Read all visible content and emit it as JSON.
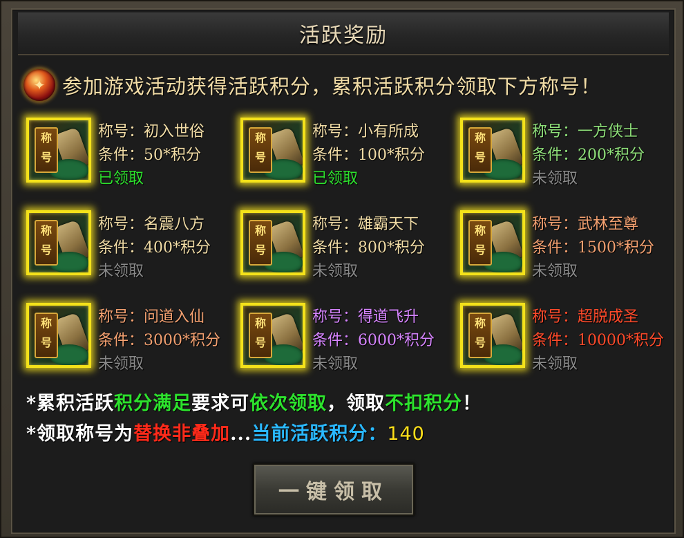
{
  "header": {
    "title": "活跃奖励"
  },
  "intro": {
    "orb_icon": "activity-orb-icon",
    "text": "参加游戏活动获得活跃积分，累积活跃积分领取下方称号！"
  },
  "titles": [
    {
      "name": "称号：初入世俗",
      "condition": "条件：50*积分",
      "status": "已领取",
      "claimed": true,
      "color": "#f1dca6"
    },
    {
      "name": "称号：小有所成",
      "condition": "条件：100*积分",
      "status": "已领取",
      "claimed": true,
      "color": "#f1dca6"
    },
    {
      "name": "称号：一方侠士",
      "condition": "条件：200*积分",
      "status": "未领取",
      "claimed": false,
      "color": "#8fe07a"
    },
    {
      "name": "称号：名震八方",
      "condition": "条件：400*积分",
      "status": "未领取",
      "claimed": false,
      "color": "#f1dca6"
    },
    {
      "name": "称号：雄霸天下",
      "condition": "条件：800*积分",
      "status": "未领取",
      "claimed": false,
      "color": "#f1dca6"
    },
    {
      "name": "称号：武林至尊",
      "condition": "条件：1500*积分",
      "status": "未领取",
      "claimed": false,
      "color": "#f3a070"
    },
    {
      "name": "称号：问道入仙",
      "condition": "条件：3000*积分",
      "status": "未领取",
      "claimed": false,
      "color": "#f3a070"
    },
    {
      "name": "称号：得道飞升",
      "condition": "条件：6000*积分",
      "status": "未领取",
      "claimed": false,
      "color": "#d684ff"
    },
    {
      "name": "称号：超脱成圣",
      "condition": "条件：10000*积分",
      "status": "未领取",
      "claimed": false,
      "color": "#ff4a2a"
    }
  ],
  "icon_tag_text": [
    "称",
    "号"
  ],
  "notes": {
    "line1": [
      "*累积活跃",
      "积分满足",
      "要求可",
      "依次领取",
      "，领取",
      "不扣积分",
      "！"
    ],
    "line2": [
      "*领取称号为",
      "替换非叠加",
      "...",
      "当前活跃积分：",
      "140"
    ]
  },
  "claim_button": {
    "label": "一键领取"
  }
}
